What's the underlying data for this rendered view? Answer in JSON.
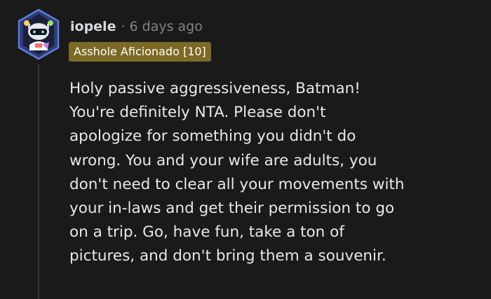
{
  "comment": {
    "author": "iopele",
    "separator": "·",
    "timestamp": "6 days ago",
    "flair": "Asshole Aficionado [10]",
    "body": "Holy passive aggressiveness, Batman!\nYou're definitely NTA. Please don't\napologize for something you didn't do\nwrong. You and your wife are adults, you\ndon't need to clear all your movements with\nyour in-laws and get their permission to go\non a trip. Go, have fun, take a ton of\npictures, and don't bring them a souvenir."
  },
  "colors": {
    "background": "#1a1a1b",
    "flair_background": "#7b6a25",
    "text_primary": "#d7dadc",
    "text_muted": "#818384",
    "thread_line": "#343536"
  },
  "icons": {
    "avatar": "snoo-robot-avatar-icon"
  }
}
